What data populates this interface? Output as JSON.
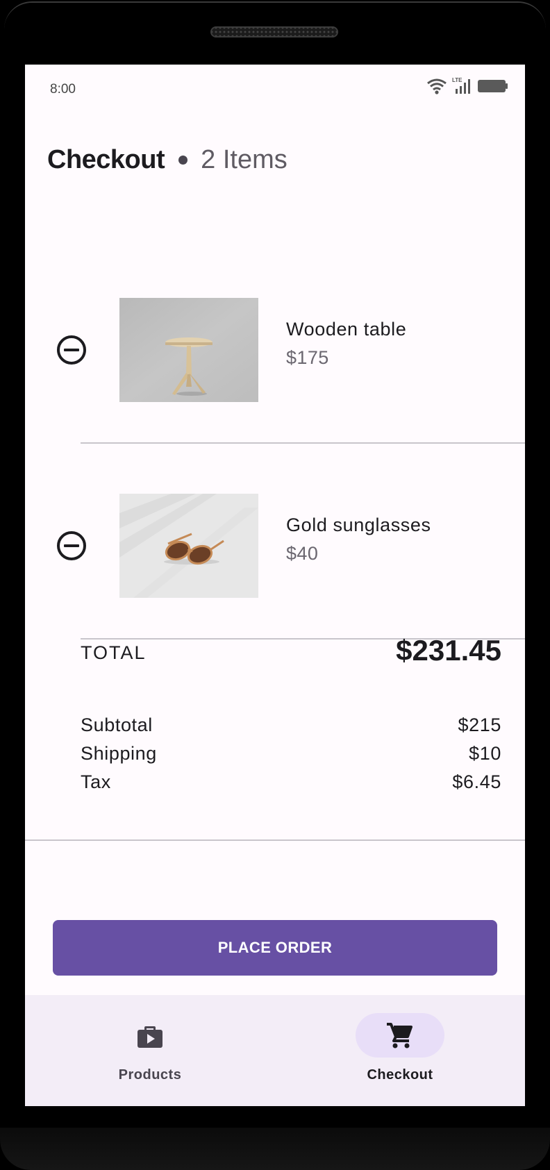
{
  "status_bar": {
    "time": "8:00",
    "network_label": "LTE",
    "icons": [
      "wifi-icon",
      "cell-signal-icon",
      "battery-icon"
    ]
  },
  "header": {
    "title": "Checkout",
    "item_count": "2 Items"
  },
  "cart_items": [
    {
      "name": "Wooden table",
      "price": "$175",
      "image": "wooden-table-image",
      "remove_icon": "remove-circle-icon"
    },
    {
      "name": "Gold sunglasses",
      "price": "$40",
      "image": "gold-sunglasses-image",
      "remove_icon": "remove-circle-icon"
    }
  ],
  "summary": {
    "total_label": "TOTAL",
    "total_value": "$231.45",
    "lines": [
      {
        "label": "Subtotal",
        "value": "$215"
      },
      {
        "label": "Shipping",
        "value": "$10"
      },
      {
        "label": "Tax",
        "value": "$6.45"
      }
    ]
  },
  "actions": {
    "place_order_label": "PLACE ORDER"
  },
  "bottom_nav": {
    "items": [
      {
        "label": "Products",
        "icon": "shopping-bag-icon",
        "active": false
      },
      {
        "label": "Checkout",
        "icon": "shopping-cart-icon",
        "active": true
      }
    ]
  },
  "colors": {
    "primary": "#6750a4",
    "surface": "#fffbfe",
    "nav_background": "#f3edf7",
    "active_indicator": "#e8def8",
    "on_surface": "#1c1b1f"
  }
}
